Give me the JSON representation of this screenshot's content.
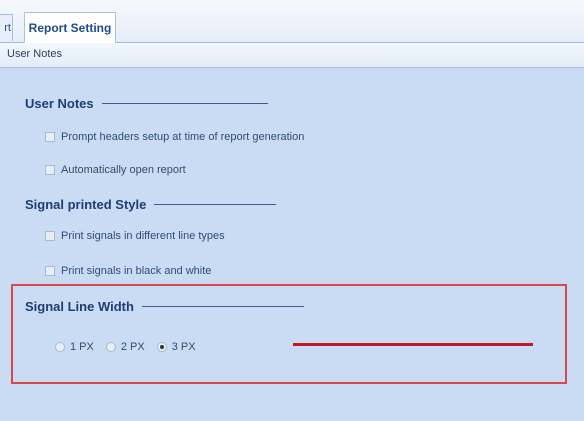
{
  "tabs": {
    "partial_label": "rt",
    "active_label": "Report Setting"
  },
  "subtab": {
    "label": "User Notes"
  },
  "sections": {
    "user_notes": {
      "title": "User Notes",
      "options": [
        {
          "label": "Prompt headers setup at time of report generation",
          "checked": false
        },
        {
          "label": "Automatically open report",
          "checked": false
        }
      ]
    },
    "signal_style": {
      "title": "Signal printed Style",
      "options": [
        {
          "label": "Print signals in different line types",
          "checked": false
        },
        {
          "label": "Print signals in black and white",
          "checked": false
        }
      ]
    },
    "line_width": {
      "title": "Signal Line Width",
      "options": [
        {
          "label": "1 PX",
          "selected": false
        },
        {
          "label": "2 PX",
          "selected": false
        },
        {
          "label": "3 PX",
          "selected": true
        }
      ],
      "preview_color": "#c4181f"
    }
  },
  "colors": {
    "panel_bg": "#c9dcf3",
    "highlight_border": "#d9484f",
    "title_text": "#1d3f73"
  }
}
